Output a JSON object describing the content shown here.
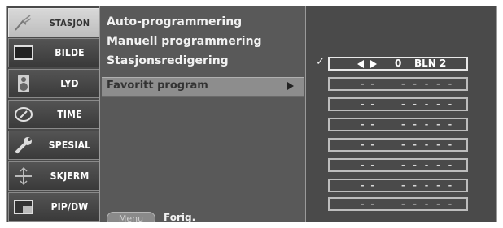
{
  "menu": {
    "items": [
      {
        "label": "STASJON",
        "icon": "antenna-icon",
        "active": true
      },
      {
        "label": "BILDE",
        "icon": "tv-screen-icon",
        "active": false
      },
      {
        "label": "LYD",
        "icon": "speaker-icon",
        "active": false
      },
      {
        "label": "TIME",
        "icon": "clock-icon",
        "active": false
      },
      {
        "label": "SPESIAL",
        "icon": "wrench-icon",
        "active": false
      },
      {
        "label": "SKJERM",
        "icon": "screen-adjust-icon",
        "active": false
      },
      {
        "label": "PIP/DW",
        "icon": "pip-icon",
        "active": false
      }
    ]
  },
  "submenu": {
    "options": [
      "Auto-programmering",
      "Manuell programmering",
      "Stasjonsredigering"
    ],
    "selected": "Favoritt program"
  },
  "footer": {
    "menu_button": "Menu",
    "back_label": "Forig."
  },
  "favorites": {
    "check": "✓",
    "first": {
      "arrows": "◄►",
      "number": "0",
      "name": "BLN 2"
    },
    "empty_number": "- -",
    "empty_name": "- - - - -"
  },
  "colors": {
    "background": "#4a4a4a",
    "panel": "#595959",
    "highlight": "#8d8d8d",
    "active_tab": "#cfcfcf"
  }
}
